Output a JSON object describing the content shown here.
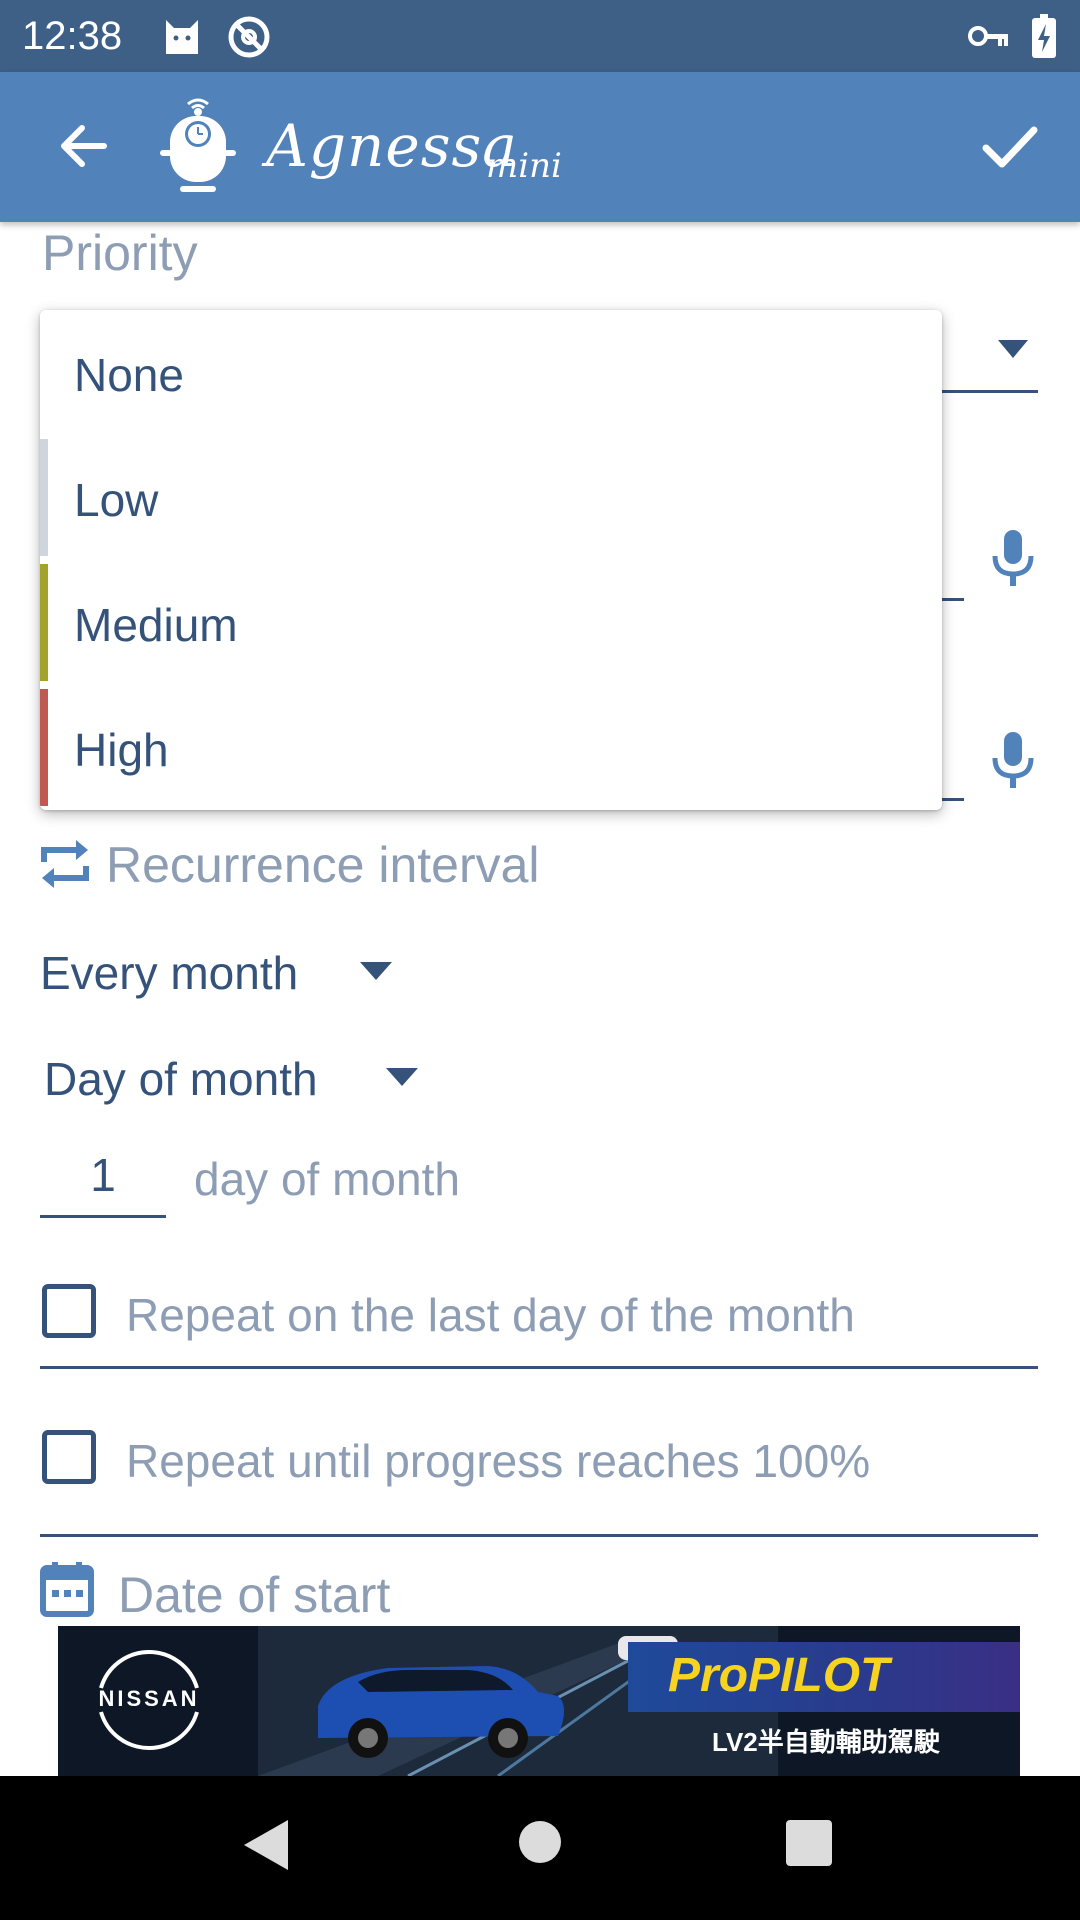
{
  "status_bar": {
    "time": "12:38",
    "icons": [
      "cat-notification-icon",
      "sync-disabled-icon",
      "vpn-key-icon",
      "battery-charging-icon"
    ]
  },
  "app_bar": {
    "title": "Agnessa",
    "title_suffix": "mini",
    "back_icon": "arrow-back-icon",
    "confirm_icon": "check-icon",
    "color": "#5182ba",
    "status_color": "#3e5f86"
  },
  "form": {
    "priority_label": "Priority",
    "recurrence_label": "Recurrence interval",
    "interval_value": "Every month",
    "mode_value": "Day of month",
    "day_value": "1",
    "day_suffix": "day of month",
    "last_day_checkbox": {
      "label": "Repeat on the last day of the month",
      "checked": false
    },
    "progress_checkbox": {
      "label": "Repeat until progress reaches 100%",
      "checked": false
    },
    "date_start_label": "Date of start"
  },
  "priority_dropdown": {
    "options": [
      {
        "label": "None",
        "color": "#ffffff"
      },
      {
        "label": "Low",
        "color": "#cfd5dc"
      },
      {
        "label": "Medium",
        "color": "#a3a32b"
      },
      {
        "label": "High",
        "color": "#bf5a52"
      }
    ]
  },
  "ad": {
    "brand": "NISSAN",
    "headline": "ProPILOT",
    "sub": "LV2半自動輔助駕駛"
  },
  "nav_bar": {
    "buttons": [
      "back-nav-icon",
      "home-nav-icon",
      "recents-nav-icon"
    ]
  },
  "colors": {
    "accent": "#34527a",
    "muted_text": "#8d9db4"
  }
}
